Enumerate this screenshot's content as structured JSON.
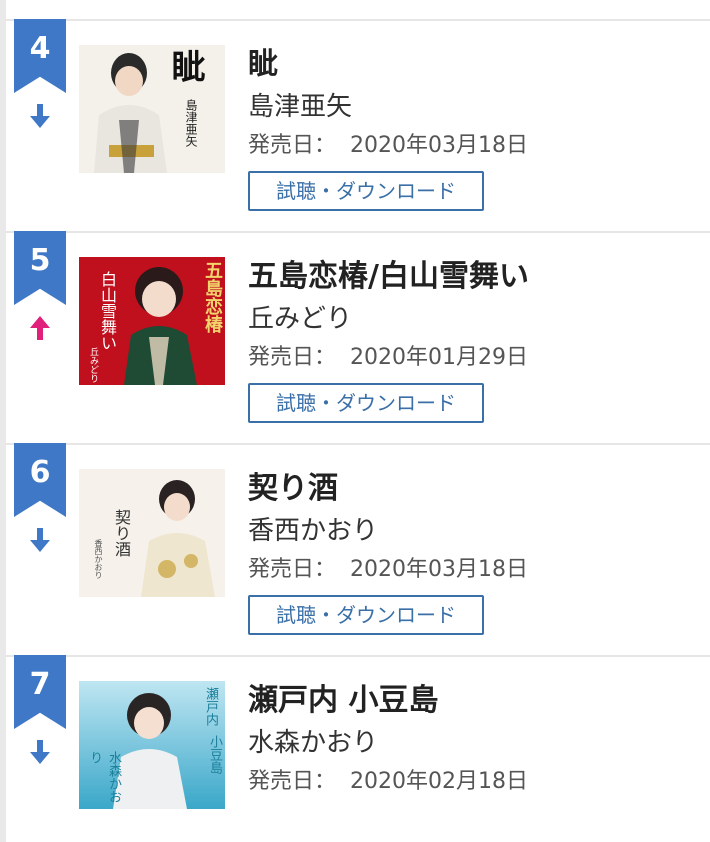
{
  "colors": {
    "badge": "#3f78c6",
    "trend_down": "#3f78c6",
    "trend_up": "#e0207a",
    "button_border": "#3a6fa8"
  },
  "items": [
    {
      "rank": "4",
      "trend": "down",
      "trend_icon": "arrow-down-icon",
      "title": "眦",
      "artist": "島津亜矢",
      "release_label": "発売日：",
      "release_date": "2020年03月18日",
      "button": "試聴・ダウンロード",
      "jacket": {
        "big": "眦",
        "small": "島津亜矢"
      }
    },
    {
      "rank": "5",
      "trend": "up",
      "trend_icon": "arrow-up-icon",
      "title": "五島恋椿/白山雪舞い",
      "artist": "丘みどり",
      "release_label": "発売日：",
      "release_date": "2020年01月29日",
      "button": "試聴・ダウンロード",
      "jacket": {
        "col1": "五島恋椿",
        "col2": "白山雪舞い",
        "small": "丘みどり"
      }
    },
    {
      "rank": "6",
      "trend": "down",
      "trend_icon": "arrow-down-icon",
      "title": "契り酒",
      "artist": "香西かおり",
      "release_label": "発売日：",
      "release_date": "2020年03月18日",
      "button": "試聴・ダウンロード",
      "jacket": {
        "col1": "契り酒",
        "small": "香西かおり"
      }
    },
    {
      "rank": "7",
      "trend": "down",
      "trend_icon": "arrow-down-icon",
      "title": "瀬戸内 小豆島",
      "artist": "水森かおり",
      "release_label": "発売日：",
      "release_date": "2020年02月18日",
      "jacket": {
        "col1": "瀬戸内",
        "col2": "小豆島",
        "small": "水森かおり"
      }
    }
  ]
}
